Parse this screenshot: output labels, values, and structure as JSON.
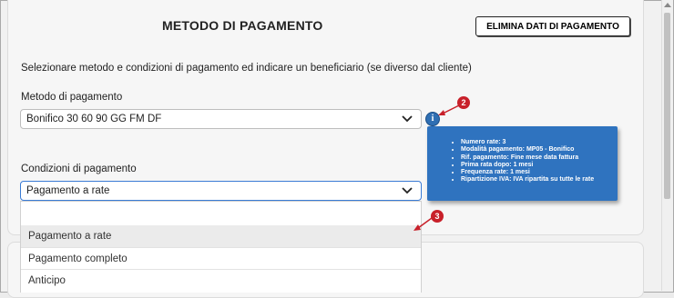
{
  "section": {
    "title": "METODO DI PAGAMENTO",
    "delete_button": "ELIMINA DATI DI PAGAMENTO",
    "instructions": "Selezionare metodo e condizioni di pagamento ed indicare un beneficiario (se diverso dal cliente)"
  },
  "payment_method": {
    "label": "Metodo di pagamento",
    "value": "Bonifico 30 60 90 GG FM DF"
  },
  "payment_conditions": {
    "label": "Condizioni di pagamento",
    "value": "Pagamento a rate",
    "options": [
      "Pagamento a rate",
      "Pagamento completo",
      "Anticipo"
    ]
  },
  "info_tooltip": {
    "icon": "info-icon",
    "items": [
      "Numero rate: 3",
      "Modalità pagamento: MP05 - Bonifico",
      "Rif. pagamento: Fine mese data fattura",
      "Prima rata dopo: 1 mesi",
      "Frequenza rate: 1 mesi",
      "Ripartizione IVA: IVA ripartita su tutte le rate"
    ]
  },
  "callouts": [
    "2",
    "3"
  ],
  "colors": {
    "tooltip_bg": "#2f73bf",
    "callout_red": "#c8202a",
    "active_border": "#3a7bd5"
  }
}
